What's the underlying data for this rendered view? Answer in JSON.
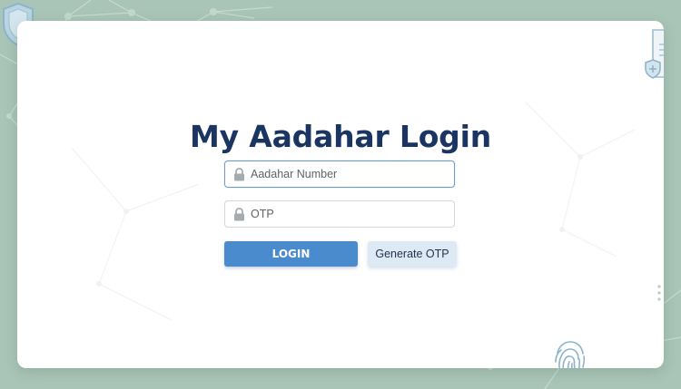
{
  "login": {
    "title": "My Aadahar Login",
    "aadhar_placeholder": "Aadahar Number",
    "otp_placeholder": "OTP",
    "login_label": "LOGIN",
    "generate_otp_label": "Generate OTP"
  },
  "icons": {
    "field_icon": "lock-icon",
    "decor": [
      "shield-icon",
      "document-shield-icon",
      "fingerprint-icon",
      "dots-grid-icon"
    ]
  },
  "colors": {
    "background": "#a9c5b7",
    "title": "#1a3562",
    "primary": "#4a8bcd",
    "secondary": "#dde9f5"
  }
}
